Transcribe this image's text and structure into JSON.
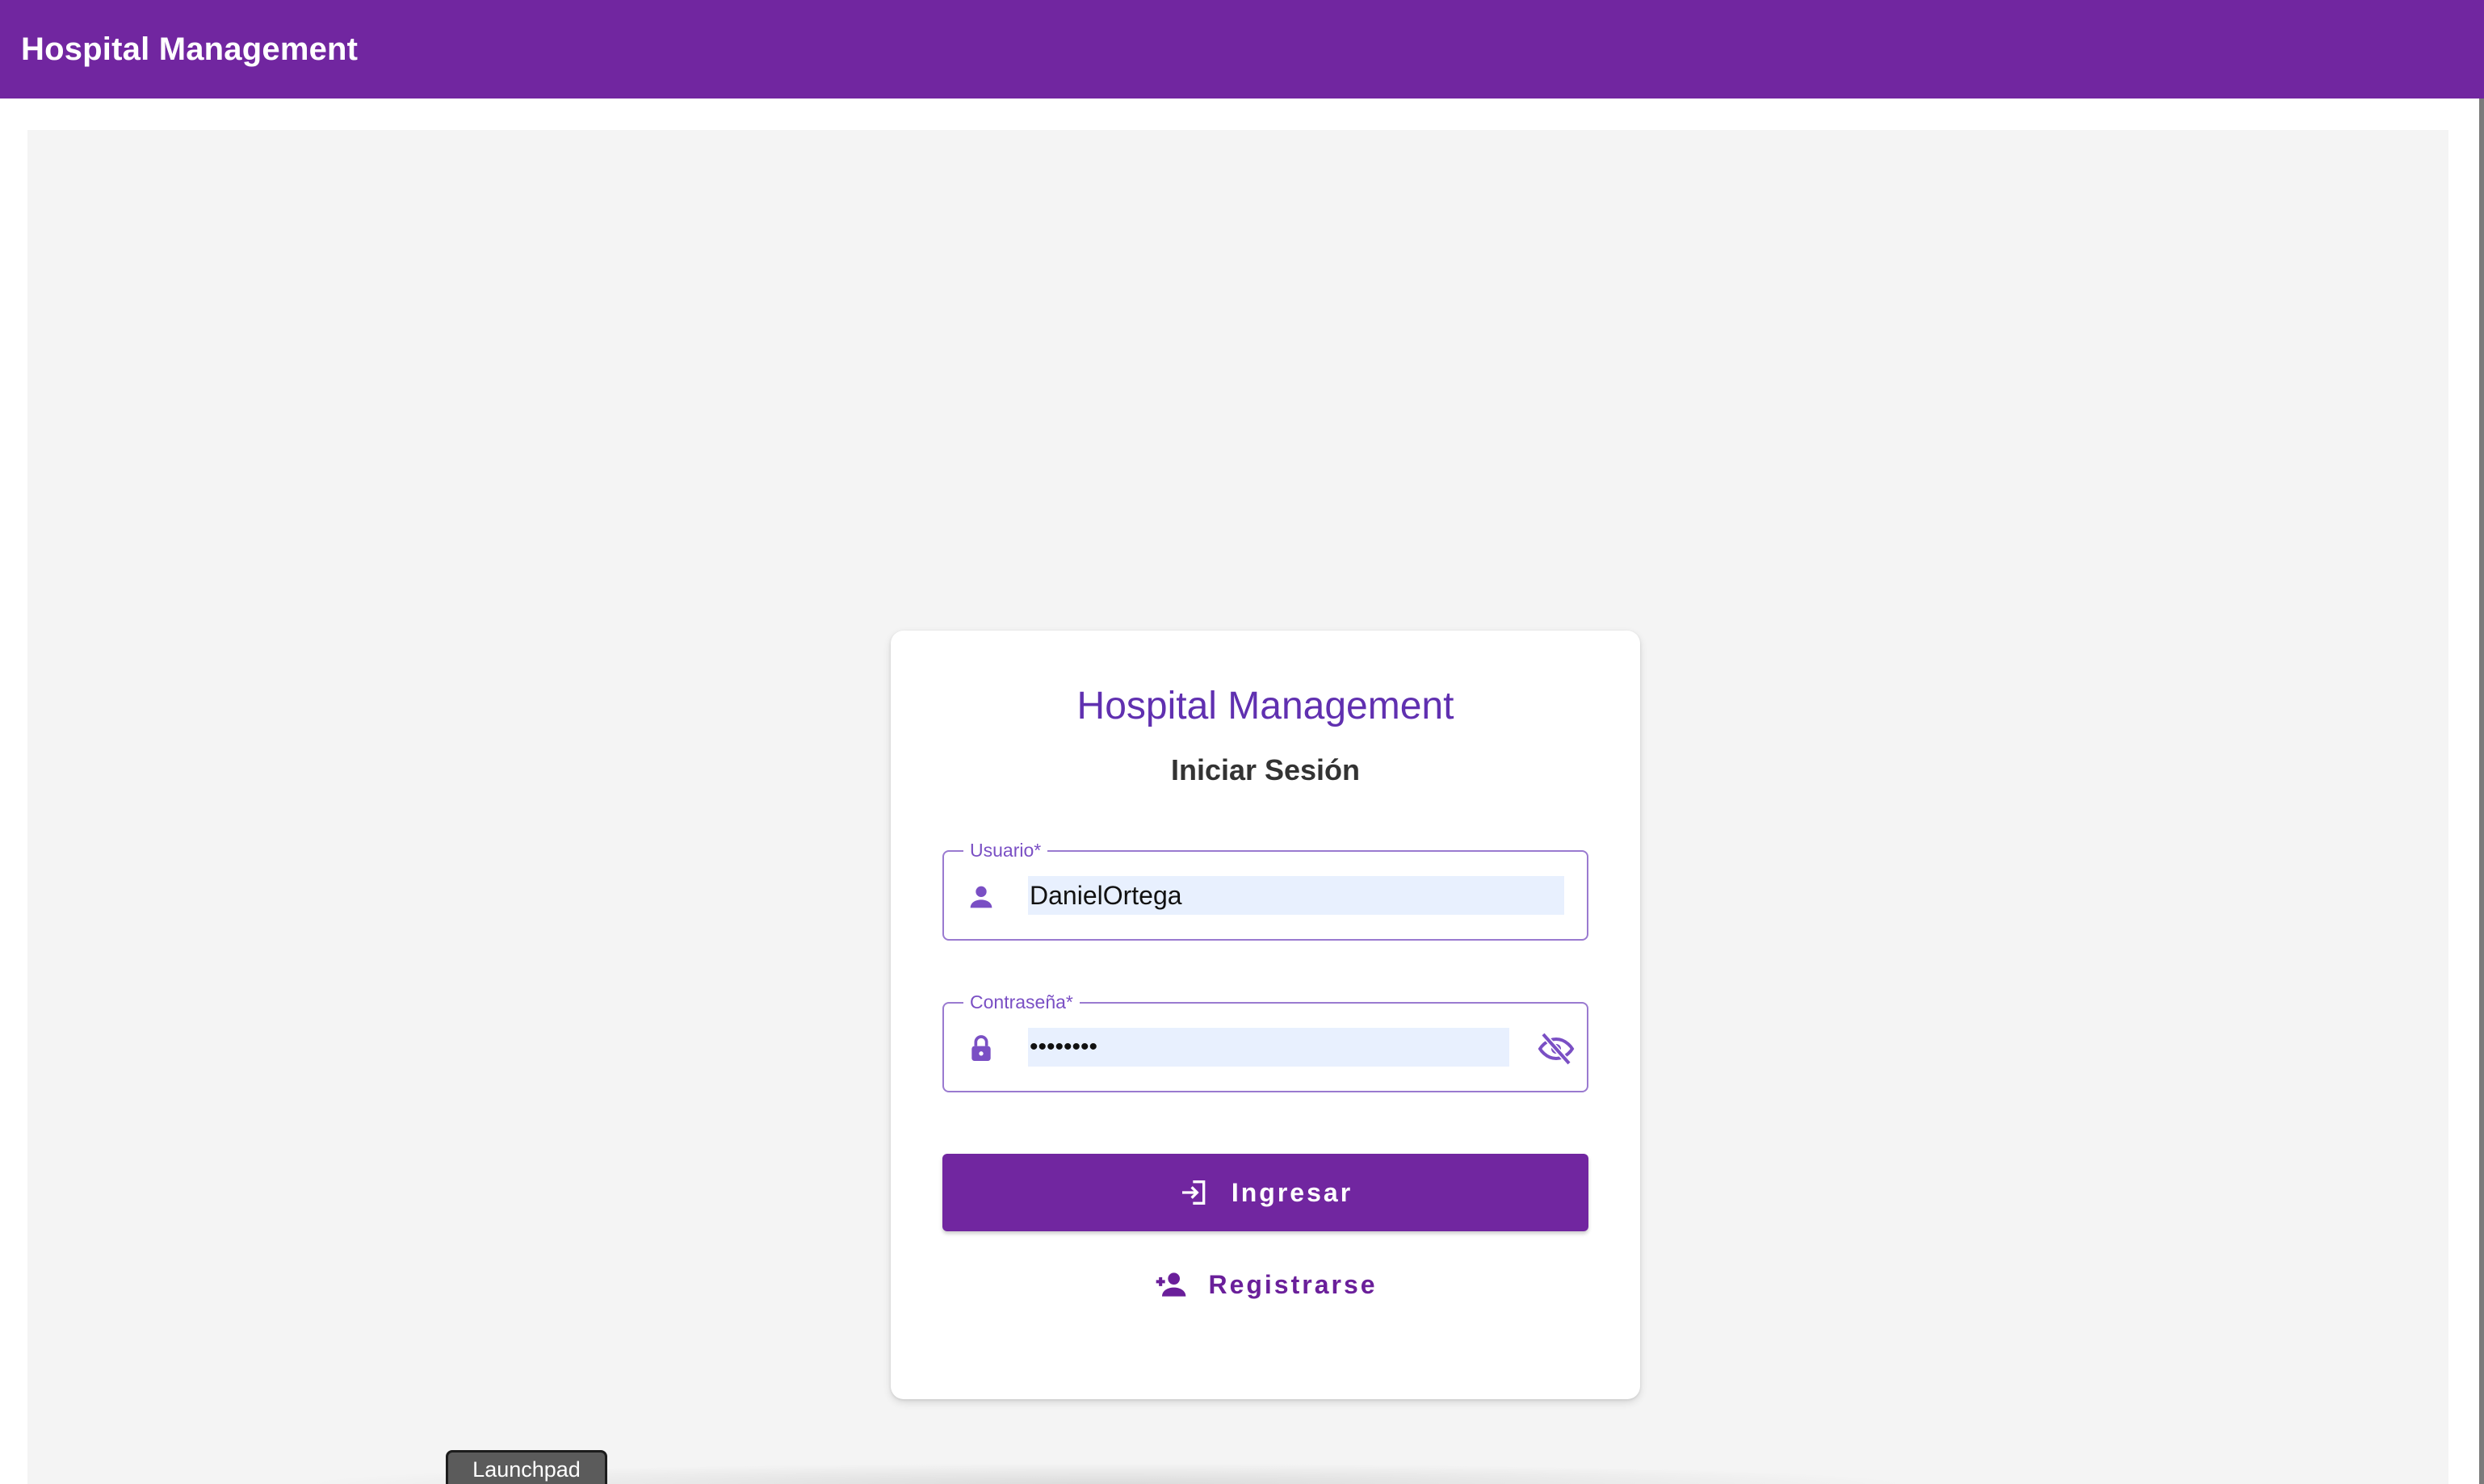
{
  "app": {
    "title": "Hospital Management",
    "accent_color": "#7126a0",
    "brand_purple": "#6030b0"
  },
  "login_card": {
    "title": "Hospital Management",
    "subtitle": "Iniciar Sesión",
    "username": {
      "label": "Usuario*",
      "value": "DanielOrtega",
      "icon": "person-icon"
    },
    "password": {
      "label": "Contraseña*",
      "value": "••••••••",
      "icon": "lock-icon",
      "toggle_icon": "eye-off-icon"
    },
    "login_button": {
      "label": "Ingresar",
      "icon": "login-icon"
    },
    "register_button": {
      "label": "Registrarse",
      "icon": "person-add-icon"
    }
  },
  "dock": {
    "tooltip": "Launchpad"
  }
}
